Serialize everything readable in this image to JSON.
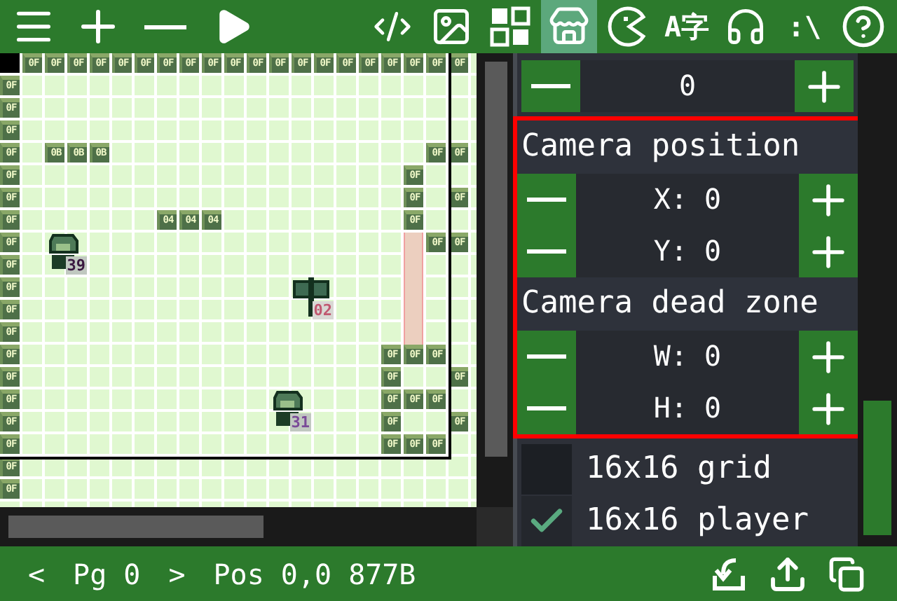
{
  "toolbar": {
    "left": [
      {
        "kind": "menu"
      },
      {
        "kind": "add"
      },
      {
        "kind": "remove"
      },
      {
        "kind": "play"
      }
    ],
    "tools": [
      {
        "kind": "code",
        "selected": false
      },
      {
        "kind": "image",
        "selected": false
      },
      {
        "kind": "tiles",
        "selected": false
      },
      {
        "kind": "shop",
        "selected": true
      },
      {
        "kind": "pacman",
        "selected": false
      },
      {
        "kind": "glyph",
        "label": "A字",
        "selected": false
      },
      {
        "kind": "headphones",
        "selected": false
      },
      {
        "kind": "glyph",
        "label": ":\\",
        "selected": false
      },
      {
        "kind": "help",
        "selected": false
      }
    ]
  },
  "map": {
    "rows": [
      {
        "cells": [
          {
            "kind": "cursor"
          },
          {
            "kind": "tile",
            "tile": "0F"
          },
          {
            "kind": "tile",
            "tile": "0F"
          },
          {
            "kind": "tile",
            "tile": "0F"
          },
          {
            "kind": "tile",
            "tile": "0F"
          },
          {
            "kind": "tile",
            "tile": "0F"
          },
          {
            "kind": "tile",
            "tile": "0F"
          },
          {
            "kind": "tile",
            "tile": "0F"
          },
          {
            "kind": "tile",
            "tile": "0F"
          },
          {
            "kind": "tile",
            "tile": "0F"
          },
          {
            "kind": "tile",
            "tile": "0F"
          },
          {
            "kind": "tile",
            "tile": "0F"
          },
          {
            "kind": "tile",
            "tile": "0F"
          },
          {
            "kind": "tile",
            "tile": "0F"
          },
          {
            "kind": "tile",
            "tile": "0F"
          },
          {
            "kind": "tile",
            "tile": "0F"
          },
          {
            "kind": "tile",
            "tile": "0F"
          },
          {
            "kind": "tile",
            "tile": "0F"
          },
          {
            "kind": "tile",
            "tile": "0F"
          },
          {
            "kind": "tile",
            "tile": "0F"
          },
          {
            "kind": "tile",
            "tile": "0F"
          }
        ]
      },
      {
        "cells": [
          {
            "kind": "tile",
            "tile": "0F"
          },
          {
            "kind": "floor"
          },
          {
            "kind": "floor"
          },
          {
            "kind": "floor"
          },
          {
            "kind": "floor"
          },
          {
            "kind": "floor"
          },
          {
            "kind": "floor"
          },
          {
            "kind": "floor"
          },
          {
            "kind": "floor"
          },
          {
            "kind": "floor"
          },
          {
            "kind": "floor"
          },
          {
            "kind": "floor"
          },
          {
            "kind": "floor"
          },
          {
            "kind": "floor"
          },
          {
            "kind": "floor"
          },
          {
            "kind": "floor"
          },
          {
            "kind": "floor"
          },
          {
            "kind": "floor"
          },
          {
            "kind": "floor"
          },
          {
            "kind": "floor"
          },
          {
            "kind": "floor"
          }
        ]
      },
      {
        "cells": [
          {
            "kind": "tile",
            "tile": "0F"
          },
          {
            "kind": "floor"
          },
          {
            "kind": "floor"
          },
          {
            "kind": "floor"
          },
          {
            "kind": "floor"
          },
          {
            "kind": "floor"
          },
          {
            "kind": "floor"
          },
          {
            "kind": "floor"
          },
          {
            "kind": "floor"
          },
          {
            "kind": "floor"
          },
          {
            "kind": "floor"
          },
          {
            "kind": "floor"
          },
          {
            "kind": "floor"
          },
          {
            "kind": "floor"
          },
          {
            "kind": "floor"
          },
          {
            "kind": "floor"
          },
          {
            "kind": "floor"
          },
          {
            "kind": "floor"
          },
          {
            "kind": "floor"
          },
          {
            "kind": "floor"
          },
          {
            "kind": "floor"
          }
        ]
      },
      {
        "cells": [
          {
            "kind": "tile",
            "tile": "0F"
          },
          {
            "kind": "floor"
          },
          {
            "kind": "floor"
          },
          {
            "kind": "floor"
          },
          {
            "kind": "floor"
          },
          {
            "kind": "floor"
          },
          {
            "kind": "floor"
          },
          {
            "kind": "floor"
          },
          {
            "kind": "floor"
          },
          {
            "kind": "floor"
          },
          {
            "kind": "floor"
          },
          {
            "kind": "floor"
          },
          {
            "kind": "floor"
          },
          {
            "kind": "floor"
          },
          {
            "kind": "floor"
          },
          {
            "kind": "floor"
          },
          {
            "kind": "floor"
          },
          {
            "kind": "floor"
          },
          {
            "kind": "floor"
          },
          {
            "kind": "floor"
          },
          {
            "kind": "floor"
          }
        ]
      },
      {
        "cells": [
          {
            "kind": "tile",
            "tile": "0F"
          },
          {
            "kind": "floor"
          },
          {
            "kind": "tile",
            "tile": "0B"
          },
          {
            "kind": "tile",
            "tile": "0B"
          },
          {
            "kind": "tile",
            "tile": "0B"
          },
          {
            "kind": "floor"
          },
          {
            "kind": "floor"
          },
          {
            "kind": "floor"
          },
          {
            "kind": "floor"
          },
          {
            "kind": "floor"
          },
          {
            "kind": "floor"
          },
          {
            "kind": "floor"
          },
          {
            "kind": "floor"
          },
          {
            "kind": "floor"
          },
          {
            "kind": "floor"
          },
          {
            "kind": "floor"
          },
          {
            "kind": "floor"
          },
          {
            "kind": "floor"
          },
          {
            "kind": "floor"
          },
          {
            "kind": "tile",
            "tile": "0F"
          },
          {
            "kind": "tile",
            "tile": "0F"
          }
        ]
      },
      {
        "cells": [
          {
            "kind": "tile",
            "tile": "0F"
          },
          {
            "kind": "floor"
          },
          {
            "kind": "floor"
          },
          {
            "kind": "floor"
          },
          {
            "kind": "floor"
          },
          {
            "kind": "floor"
          },
          {
            "kind": "floor"
          },
          {
            "kind": "floor"
          },
          {
            "kind": "floor"
          },
          {
            "kind": "floor"
          },
          {
            "kind": "floor"
          },
          {
            "kind": "floor"
          },
          {
            "kind": "floor"
          },
          {
            "kind": "floor"
          },
          {
            "kind": "floor"
          },
          {
            "kind": "floor"
          },
          {
            "kind": "floor"
          },
          {
            "kind": "floor"
          },
          {
            "kind": "tile",
            "tile": "0F"
          },
          {
            "kind": "floor"
          },
          {
            "kind": "floor"
          }
        ]
      },
      {
        "cells": [
          {
            "kind": "tile",
            "tile": "0F"
          },
          {
            "kind": "floor"
          },
          {
            "kind": "floor"
          },
          {
            "kind": "floor"
          },
          {
            "kind": "floor"
          },
          {
            "kind": "floor"
          },
          {
            "kind": "floor"
          },
          {
            "kind": "floor"
          },
          {
            "kind": "floor"
          },
          {
            "kind": "floor"
          },
          {
            "kind": "floor"
          },
          {
            "kind": "floor"
          },
          {
            "kind": "floor"
          },
          {
            "kind": "floor"
          },
          {
            "kind": "floor"
          },
          {
            "kind": "floor"
          },
          {
            "kind": "floor"
          },
          {
            "kind": "floor"
          },
          {
            "kind": "tile",
            "tile": "0F"
          },
          {
            "kind": "floor"
          },
          {
            "kind": "tile",
            "tile": "0F"
          }
        ]
      },
      {
        "cells": [
          {
            "kind": "tile",
            "tile": "0F"
          },
          {
            "kind": "floor"
          },
          {
            "kind": "floor"
          },
          {
            "kind": "floor"
          },
          {
            "kind": "floor"
          },
          {
            "kind": "floor"
          },
          {
            "kind": "floor"
          },
          {
            "kind": "tile",
            "tile": "04"
          },
          {
            "kind": "tile",
            "tile": "04"
          },
          {
            "kind": "tile",
            "tile": "04"
          },
          {
            "kind": "floor"
          },
          {
            "kind": "floor"
          },
          {
            "kind": "floor"
          },
          {
            "kind": "floor"
          },
          {
            "kind": "floor"
          },
          {
            "kind": "floor"
          },
          {
            "kind": "floor"
          },
          {
            "kind": "floor"
          },
          {
            "kind": "tile",
            "tile": "0F"
          },
          {
            "kind": "floor"
          },
          {
            "kind": "floor"
          }
        ]
      },
      {
        "cells": [
          {
            "kind": "tile",
            "tile": "0F"
          },
          {
            "kind": "floor"
          },
          {
            "kind": "floor"
          },
          {
            "kind": "floor"
          },
          {
            "kind": "floor"
          },
          {
            "kind": "floor"
          },
          {
            "kind": "floor"
          },
          {
            "kind": "floor"
          },
          {
            "kind": "floor"
          },
          {
            "kind": "floor"
          },
          {
            "kind": "floor"
          },
          {
            "kind": "floor"
          },
          {
            "kind": "floor"
          },
          {
            "kind": "floor"
          },
          {
            "kind": "floor"
          },
          {
            "kind": "floor"
          },
          {
            "kind": "floor"
          },
          {
            "kind": "floor"
          },
          {
            "kind": "trigger"
          },
          {
            "kind": "tile",
            "tile": "0F"
          },
          {
            "kind": "tile",
            "tile": "0F"
          }
        ]
      },
      {
        "cells": [
          {
            "kind": "tile",
            "tile": "0F"
          },
          {
            "kind": "floor"
          },
          {
            "kind": "floor"
          },
          {
            "kind": "person",
            "label": "39",
            "color": "#3a1840"
          },
          {
            "kind": "floor"
          },
          {
            "kind": "floor"
          },
          {
            "kind": "floor"
          },
          {
            "kind": "floor"
          },
          {
            "kind": "floor"
          },
          {
            "kind": "floor"
          },
          {
            "kind": "floor"
          },
          {
            "kind": "floor"
          },
          {
            "kind": "floor"
          },
          {
            "kind": "floor"
          },
          {
            "kind": "floor"
          },
          {
            "kind": "floor"
          },
          {
            "kind": "floor"
          },
          {
            "kind": "floor"
          },
          {
            "kind": "trigger"
          },
          {
            "kind": "floor"
          },
          {
            "kind": "floor"
          }
        ]
      },
      {
        "cells": [
          {
            "kind": "tile",
            "tile": "0F"
          },
          {
            "kind": "floor"
          },
          {
            "kind": "floor"
          },
          {
            "kind": "floor"
          },
          {
            "kind": "floor"
          },
          {
            "kind": "floor"
          },
          {
            "kind": "floor"
          },
          {
            "kind": "floor"
          },
          {
            "kind": "floor"
          },
          {
            "kind": "floor"
          },
          {
            "kind": "floor"
          },
          {
            "kind": "floor"
          },
          {
            "kind": "floor"
          },
          {
            "kind": "floor"
          },
          {
            "kind": "floor"
          },
          {
            "kind": "floor"
          },
          {
            "kind": "floor"
          },
          {
            "kind": "floor"
          },
          {
            "kind": "trigger"
          },
          {
            "kind": "floor"
          },
          {
            "kind": "floor"
          }
        ]
      },
      {
        "cells": [
          {
            "kind": "tile",
            "tile": "0F"
          },
          {
            "kind": "floor"
          },
          {
            "kind": "floor"
          },
          {
            "kind": "floor"
          },
          {
            "kind": "floor"
          },
          {
            "kind": "floor"
          },
          {
            "kind": "floor"
          },
          {
            "kind": "floor"
          },
          {
            "kind": "floor"
          },
          {
            "kind": "floor"
          },
          {
            "kind": "floor"
          },
          {
            "kind": "floor"
          },
          {
            "kind": "floor"
          },
          {
            "kind": "floor"
          },
          {
            "kind": "sign",
            "label": "02",
            "color": "#c05870"
          },
          {
            "kind": "floor"
          },
          {
            "kind": "floor"
          },
          {
            "kind": "floor"
          },
          {
            "kind": "trigger"
          },
          {
            "kind": "floor"
          },
          {
            "kind": "floor"
          }
        ]
      },
      {
        "cells": [
          {
            "kind": "tile",
            "tile": "0F"
          },
          {
            "kind": "floor"
          },
          {
            "kind": "floor"
          },
          {
            "kind": "floor"
          },
          {
            "kind": "floor"
          },
          {
            "kind": "floor"
          },
          {
            "kind": "floor"
          },
          {
            "kind": "floor"
          },
          {
            "kind": "floor"
          },
          {
            "kind": "floor"
          },
          {
            "kind": "floor"
          },
          {
            "kind": "floor"
          },
          {
            "kind": "floor"
          },
          {
            "kind": "floor"
          },
          {
            "kind": "floor"
          },
          {
            "kind": "floor"
          },
          {
            "kind": "floor"
          },
          {
            "kind": "floor"
          },
          {
            "kind": "trigger"
          },
          {
            "kind": "floor"
          },
          {
            "kind": "floor"
          }
        ]
      },
      {
        "cells": [
          {
            "kind": "tile",
            "tile": "0F"
          },
          {
            "kind": "floor"
          },
          {
            "kind": "floor"
          },
          {
            "kind": "floor"
          },
          {
            "kind": "floor"
          },
          {
            "kind": "floor"
          },
          {
            "kind": "floor"
          },
          {
            "kind": "floor"
          },
          {
            "kind": "floor"
          },
          {
            "kind": "floor"
          },
          {
            "kind": "floor"
          },
          {
            "kind": "floor"
          },
          {
            "kind": "floor"
          },
          {
            "kind": "floor"
          },
          {
            "kind": "floor"
          },
          {
            "kind": "floor"
          },
          {
            "kind": "floor"
          },
          {
            "kind": "tile",
            "tile": "0F"
          },
          {
            "kind": "tile",
            "tile": "0F"
          },
          {
            "kind": "tile",
            "tile": "0F"
          },
          {
            "kind": "floor"
          }
        ]
      },
      {
        "cells": [
          {
            "kind": "tile",
            "tile": "0F"
          },
          {
            "kind": "floor"
          },
          {
            "kind": "floor"
          },
          {
            "kind": "floor"
          },
          {
            "kind": "floor"
          },
          {
            "kind": "floor"
          },
          {
            "kind": "floor"
          },
          {
            "kind": "floor"
          },
          {
            "kind": "floor"
          },
          {
            "kind": "floor"
          },
          {
            "kind": "floor"
          },
          {
            "kind": "floor"
          },
          {
            "kind": "floor"
          },
          {
            "kind": "floor"
          },
          {
            "kind": "floor"
          },
          {
            "kind": "floor"
          },
          {
            "kind": "floor"
          },
          {
            "kind": "tile",
            "tile": "0F"
          },
          {
            "kind": "floor"
          },
          {
            "kind": "floor"
          },
          {
            "kind": "tile",
            "tile": "0F"
          }
        ]
      },
      {
        "cells": [
          {
            "kind": "tile",
            "tile": "0F"
          },
          {
            "kind": "floor"
          },
          {
            "kind": "floor"
          },
          {
            "kind": "floor"
          },
          {
            "kind": "floor"
          },
          {
            "kind": "floor"
          },
          {
            "kind": "floor"
          },
          {
            "kind": "floor"
          },
          {
            "kind": "floor"
          },
          {
            "kind": "floor"
          },
          {
            "kind": "floor"
          },
          {
            "kind": "floor"
          },
          {
            "kind": "floor"
          },
          {
            "kind": "floor"
          },
          {
            "kind": "floor"
          },
          {
            "kind": "floor"
          },
          {
            "kind": "floor"
          },
          {
            "kind": "tile",
            "tile": "0F"
          },
          {
            "kind": "tile",
            "tile": "0F"
          },
          {
            "kind": "tile",
            "tile": "0F"
          },
          {
            "kind": "floor"
          }
        ]
      },
      {
        "cells": [
          {
            "kind": "tile",
            "tile": "0F"
          },
          {
            "kind": "floor"
          },
          {
            "kind": "floor"
          },
          {
            "kind": "floor"
          },
          {
            "kind": "floor"
          },
          {
            "kind": "floor"
          },
          {
            "kind": "floor"
          },
          {
            "kind": "floor"
          },
          {
            "kind": "floor"
          },
          {
            "kind": "floor"
          },
          {
            "kind": "floor"
          },
          {
            "kind": "floor"
          },
          {
            "kind": "floor"
          },
          {
            "kind": "person",
            "label": "31",
            "color": "#7a4a98"
          },
          {
            "kind": "floor"
          },
          {
            "kind": "floor"
          },
          {
            "kind": "floor"
          },
          {
            "kind": "tile",
            "tile": "0F"
          },
          {
            "kind": "floor"
          },
          {
            "kind": "floor"
          },
          {
            "kind": "tile",
            "tile": "0F"
          }
        ]
      },
      {
        "cells": [
          {
            "kind": "tile",
            "tile": "0F"
          },
          {
            "kind": "floor"
          },
          {
            "kind": "floor"
          },
          {
            "kind": "floor"
          },
          {
            "kind": "floor"
          },
          {
            "kind": "floor"
          },
          {
            "kind": "floor"
          },
          {
            "kind": "floor"
          },
          {
            "kind": "floor"
          },
          {
            "kind": "floor"
          },
          {
            "kind": "floor"
          },
          {
            "kind": "floor"
          },
          {
            "kind": "floor"
          },
          {
            "kind": "floor"
          },
          {
            "kind": "floor"
          },
          {
            "kind": "floor"
          },
          {
            "kind": "floor"
          },
          {
            "kind": "tile",
            "tile": "0F"
          },
          {
            "kind": "tile",
            "tile": "0F"
          },
          {
            "kind": "tile",
            "tile": "0F"
          },
          {
            "kind": "floor"
          }
        ]
      },
      {
        "cells": [
          {
            "kind": "tile",
            "tile": "0F"
          },
          {
            "kind": "floor"
          },
          {
            "kind": "floor"
          },
          {
            "kind": "floor"
          },
          {
            "kind": "floor"
          },
          {
            "kind": "floor"
          },
          {
            "kind": "floor"
          },
          {
            "kind": "floor"
          },
          {
            "kind": "floor"
          },
          {
            "kind": "floor"
          },
          {
            "kind": "floor"
          },
          {
            "kind": "floor"
          },
          {
            "kind": "floor"
          },
          {
            "kind": "floor"
          },
          {
            "kind": "floor"
          },
          {
            "kind": "floor"
          },
          {
            "kind": "floor"
          },
          {
            "kind": "floor"
          },
          {
            "kind": "floor"
          },
          {
            "kind": "floor"
          },
          {
            "kind": "floor"
          }
        ]
      },
      {
        "cells": [
          {
            "kind": "tile",
            "tile": "0F"
          },
          {
            "kind": "floor"
          },
          {
            "kind": "floor"
          },
          {
            "kind": "floor"
          },
          {
            "kind": "floor"
          },
          {
            "kind": "floor"
          },
          {
            "kind": "floor"
          },
          {
            "kind": "floor"
          },
          {
            "kind": "floor"
          },
          {
            "kind": "floor"
          },
          {
            "kind": "floor"
          },
          {
            "kind": "floor"
          },
          {
            "kind": "floor"
          },
          {
            "kind": "floor"
          },
          {
            "kind": "floor"
          },
          {
            "kind": "floor"
          },
          {
            "kind": "floor"
          },
          {
            "kind": "floor"
          },
          {
            "kind": "floor"
          },
          {
            "kind": "floor"
          },
          {
            "kind": "floor"
          }
        ]
      }
    ]
  },
  "panel": {
    "sections": [
      {
        "highlighted": false,
        "rows": [
          {
            "kind": "stepper",
            "value": "0"
          }
        ]
      },
      {
        "highlighted": true,
        "rows": [
          {
            "kind": "heading",
            "text": "Camera position"
          },
          {
            "kind": "stepper",
            "value": "X: 0"
          },
          {
            "kind": "stepper",
            "value": "Y: 0"
          },
          {
            "kind": "heading",
            "text": "Camera dead zone"
          },
          {
            "kind": "stepper",
            "value": "W: 0"
          },
          {
            "kind": "stepper",
            "value": "H: 0"
          }
        ]
      },
      {
        "highlighted": false,
        "rows": [
          {
            "kind": "check",
            "text": "16x16 grid",
            "checked": false
          },
          {
            "kind": "check",
            "text": "16x16 player",
            "checked": true
          }
        ]
      }
    ]
  },
  "status": {
    "prev": "<",
    "page": "Pg 0",
    "next": ">",
    "position": "Pos 0,0",
    "size": "877B",
    "actions": [
      {
        "kind": "import"
      },
      {
        "kind": "export"
      },
      {
        "kind": "copy"
      }
    ]
  }
}
